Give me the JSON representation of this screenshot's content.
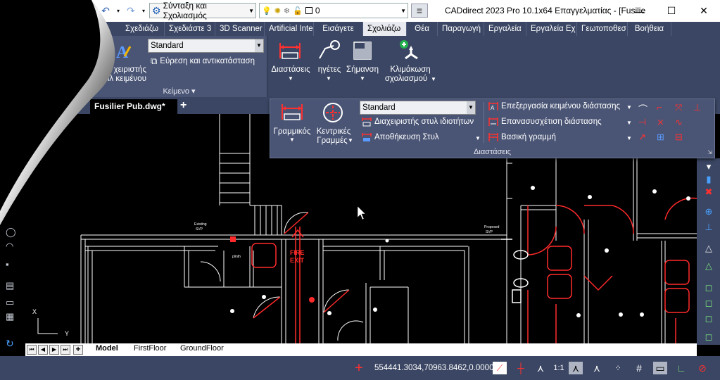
{
  "titlebar": {
    "workspace": "Σύνταξη και Σχολιασμός",
    "layer": "0",
    "title": "CADdirect 2023 Pro 10.1x64 Επαγγελματίας - [Fusilie",
    "minimize": "—",
    "maximize": "☐",
    "close": "✕"
  },
  "ribbon": {
    "tabs": [
      "Σχεδιάζω",
      "Σχεδιάστε 3",
      "3D Scanner",
      "Artificial Inte",
      "Εισάγετε",
      "Σχολιάζω",
      "Θέα",
      "Παραγωγή",
      "Εργαλεία",
      "Εργαλεία Εχ",
      "Γεωτοποθεσ",
      "Βοήθεια"
    ],
    "active_tab": "Σχολιάζω",
    "text_panel": {
      "title": "Κείμενο",
      "style": "Standard",
      "find_replace": "Εύρεση και αντικατάσταση",
      "manager_line1": "χειριστής",
      "manager_line2": "ιλ κειμένου"
    },
    "main_buttons": {
      "dimensions": "Διαστάσεις",
      "leaders": "ηγέτες",
      "mark": "Σήμανση",
      "scale_line1": "Κλιμάκωση",
      "scale_line2": "σχολιασμού"
    }
  },
  "document": {
    "tab": "Fusilier Pub.dwg*",
    "add": "+"
  },
  "dim_panel": {
    "title": "Διαστάσεις",
    "linear": "Γραμμικός",
    "center_line1": "Κεντρικές",
    "center_line2": "Γραμμές",
    "style": "Standard",
    "style_manager": "Διαχειριστής στυλ ιδιοτήτων",
    "save_style": "Αποθήκευση Στυλ",
    "edit_text": "Επεξεργασία κειμένου διάστασης",
    "reassociate": "Επανασυσχέτιση διάστασης",
    "baseline": "Βασική γραμμή"
  },
  "drawing": {
    "fire_exit_1": "FIRE",
    "fire_exit_2": "EXIT",
    "label_existing_1": "Existing",
    "label_existing_2": "SVP",
    "label_proposed_1": "Proposed",
    "label_proposed_2": "SVP",
    "label_plinth": "plinth"
  },
  "layouts": {
    "tabs": [
      "Model",
      "FirstFloor",
      "GroundFloor"
    ],
    "active": "Model"
  },
  "status": {
    "coordinates": "554441.3034,70963.8462,0.0000",
    "scale": "1:1"
  },
  "colors": {
    "accent_red": "#ff2a2a",
    "ribbon_bg": "#3a4663",
    "panel_bg": "#4a5575"
  }
}
